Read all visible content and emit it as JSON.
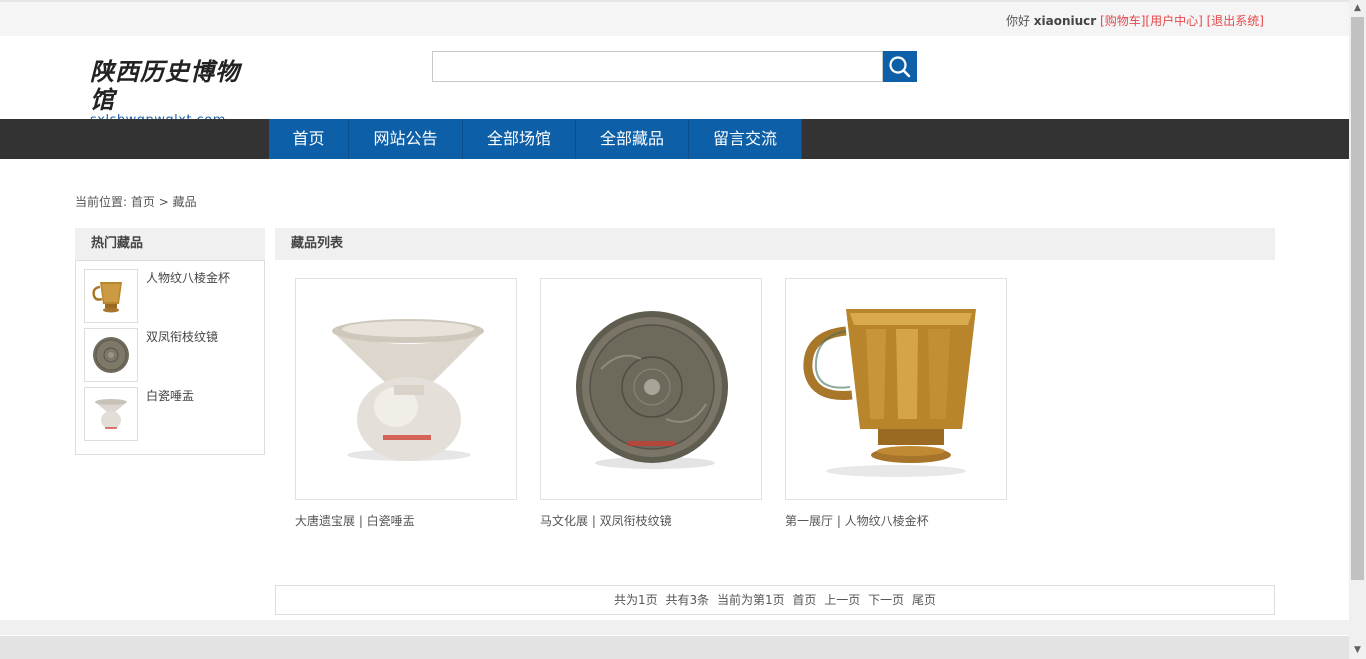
{
  "topbar": {
    "greeting": "你好",
    "username": "xiaoniucr",
    "cart": "[购物车]",
    "user_center": "[用户中心]",
    "logout": "[退出系统]"
  },
  "header": {
    "logo_text": "陕西历史博物馆",
    "logo_domain": "sxlsbwgpwglxt.com",
    "search_placeholder": ""
  },
  "nav": {
    "items": [
      "首页",
      "网站公告",
      "全部场馆",
      "全部藏品",
      "留言交流"
    ]
  },
  "breadcrumb": {
    "prefix": "当前位置:",
    "home": "首页",
    "sep": ">",
    "current": "藏品"
  },
  "hot": {
    "title": "热门藏品",
    "items": [
      {
        "name": "人物纹八棱金杯",
        "icon": "gold-cup-thumb"
      },
      {
        "name": "双凤衔枝纹镜",
        "icon": "bronze-mirror-thumb"
      },
      {
        "name": "白瓷唾盂",
        "icon": "white-porcelain-thumb"
      }
    ]
  },
  "list": {
    "title": "藏品列表",
    "items": [
      {
        "caption": "大唐遗宝展 | 白瓷唾盂",
        "icon": "white-porcelain-spittoon"
      },
      {
        "caption": "马文化展 | 双凤衔枝纹镜",
        "icon": "bronze-mirror"
      },
      {
        "caption": "第一展厅 | 人物纹八棱金杯",
        "icon": "gold-octagonal-cup"
      }
    ]
  },
  "pager": {
    "total_pages": "共为1页",
    "total_items": "共有3条",
    "current": "当前为第1页",
    "first": "首页",
    "prev": "上一页",
    "next": "下一页",
    "last": "尾页"
  },
  "colors": {
    "nav_blue": "#0d5fa8",
    "nav_bar": "#333333",
    "link_red": "#e5484d"
  }
}
